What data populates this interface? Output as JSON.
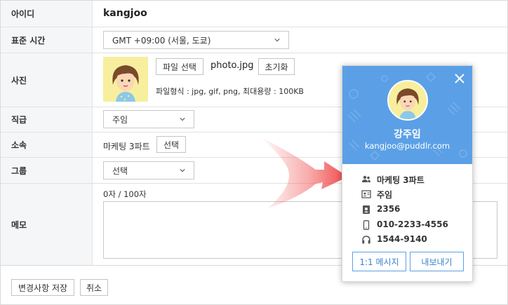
{
  "form": {
    "id_label": "아이디",
    "id_value": "kangjoo",
    "timezone_label": "표준 시간",
    "timezone_value": "GMT +09:00 (서울, 도쿄)",
    "photo_label": "사진",
    "file_button": "파일 선택",
    "file_name": "photo.jpg",
    "reset_button": "초기화",
    "file_hint": "파일형식 : jpg, gif, png, 최대용량 : 100KB",
    "rank_label": "직급",
    "rank_value": "주임",
    "dept_label": "소속",
    "dept_value": "마케팅 3파트",
    "dept_button": "선택",
    "group_label": "그룹",
    "group_value": "선택",
    "memo_label": "메모",
    "memo_count": "0자 / 100자",
    "save_button": "변경사항 저장",
    "cancel_button": "취소"
  },
  "card": {
    "name": "강주임",
    "email": "kangjoo@puddlr.com",
    "dept": "마케팅 3파트",
    "rank": "주임",
    "ext": "2356",
    "mobile": "010-2233-4556",
    "phone": "1544-9140",
    "message_button": "1:1 메시지",
    "export_button": "내보내기"
  },
  "icons": {
    "close": "close-icon",
    "chevron": "chevron-down-icon",
    "dept": "people-icon",
    "rank": "badge-icon",
    "ext": "contact-icon",
    "mobile": "smartphone-icon",
    "phone": "headset-icon"
  },
  "colors": {
    "card_header": "#5ba0e6",
    "accent": "#3b82d0",
    "arrow": "#f04848",
    "avatar_bg": "#f7ef9e"
  }
}
